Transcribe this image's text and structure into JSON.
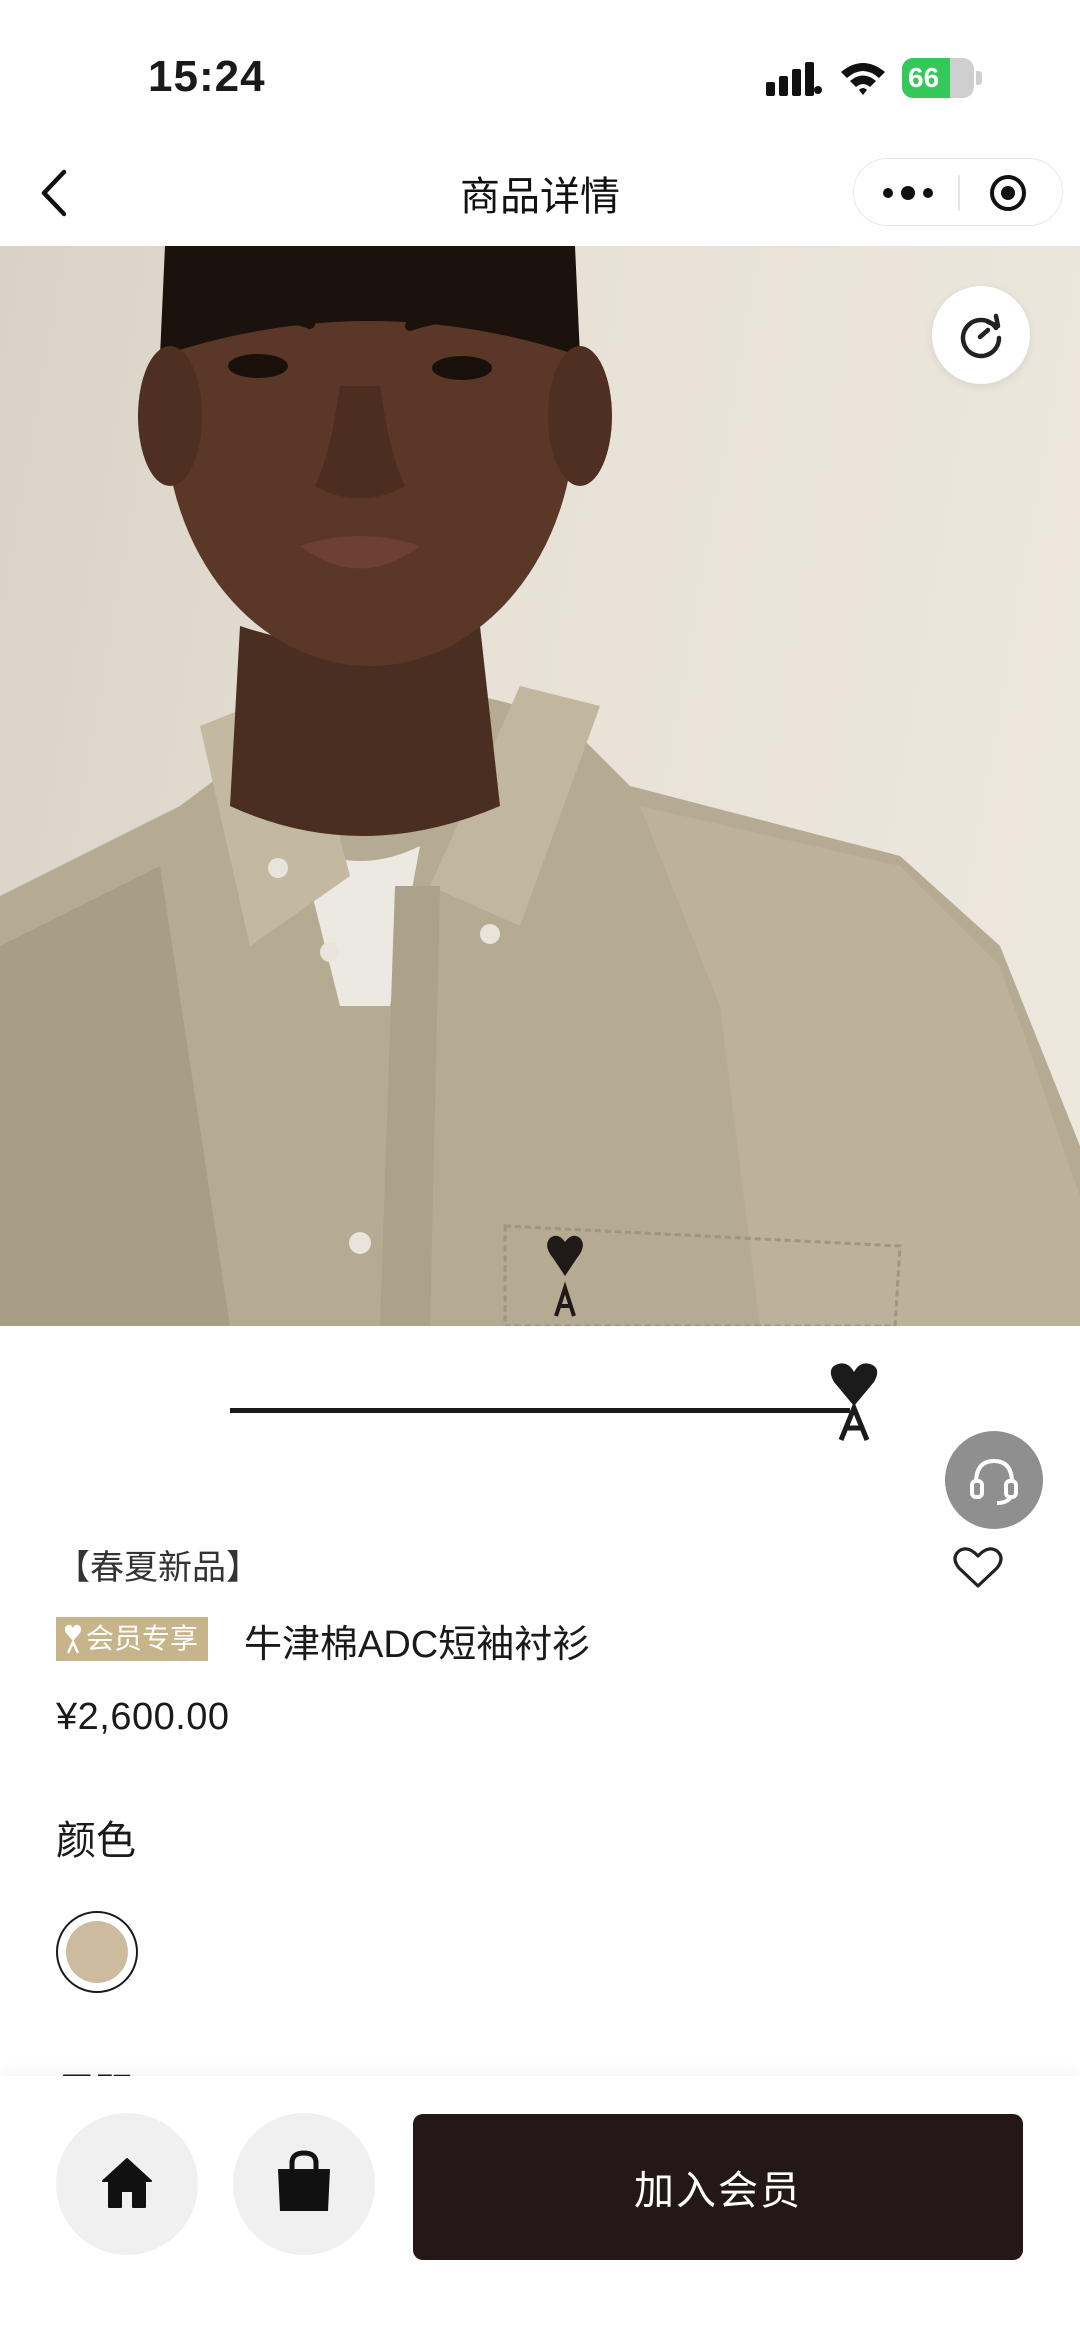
{
  "status_bar": {
    "time": "15:24",
    "battery_level": "66",
    "battery_percent": 66,
    "icons": [
      "signal-icon",
      "wifi-icon",
      "battery-icon"
    ]
  },
  "nav": {
    "title": "商品详情",
    "icons": [
      "back-icon",
      "more-icon",
      "target-icon"
    ]
  },
  "hero": {
    "image_subject": "model wearing khaki oxford short-sleeve shirt",
    "background_color": "#e4ddd1",
    "shirt_color": "#b5aa92"
  },
  "carousel": {
    "progress": 1.0
  },
  "product": {
    "tag": "【春夏新品】",
    "member_badge": "会员专享",
    "name": "牛津棉ADC短袖衬衫",
    "price": "¥2,600.00"
  },
  "options": {
    "color_label": "颜色",
    "selected_color": "#cdbb9f",
    "size_label": "尺码"
  },
  "bottom_bar": {
    "join_label": "加入会员",
    "icons": [
      "home-icon",
      "shopping-bag-icon"
    ]
  },
  "colors": {
    "accent_gold": "#c8b48a",
    "primary_dark": "#231717",
    "service_gray": "#8f8f8f"
  }
}
